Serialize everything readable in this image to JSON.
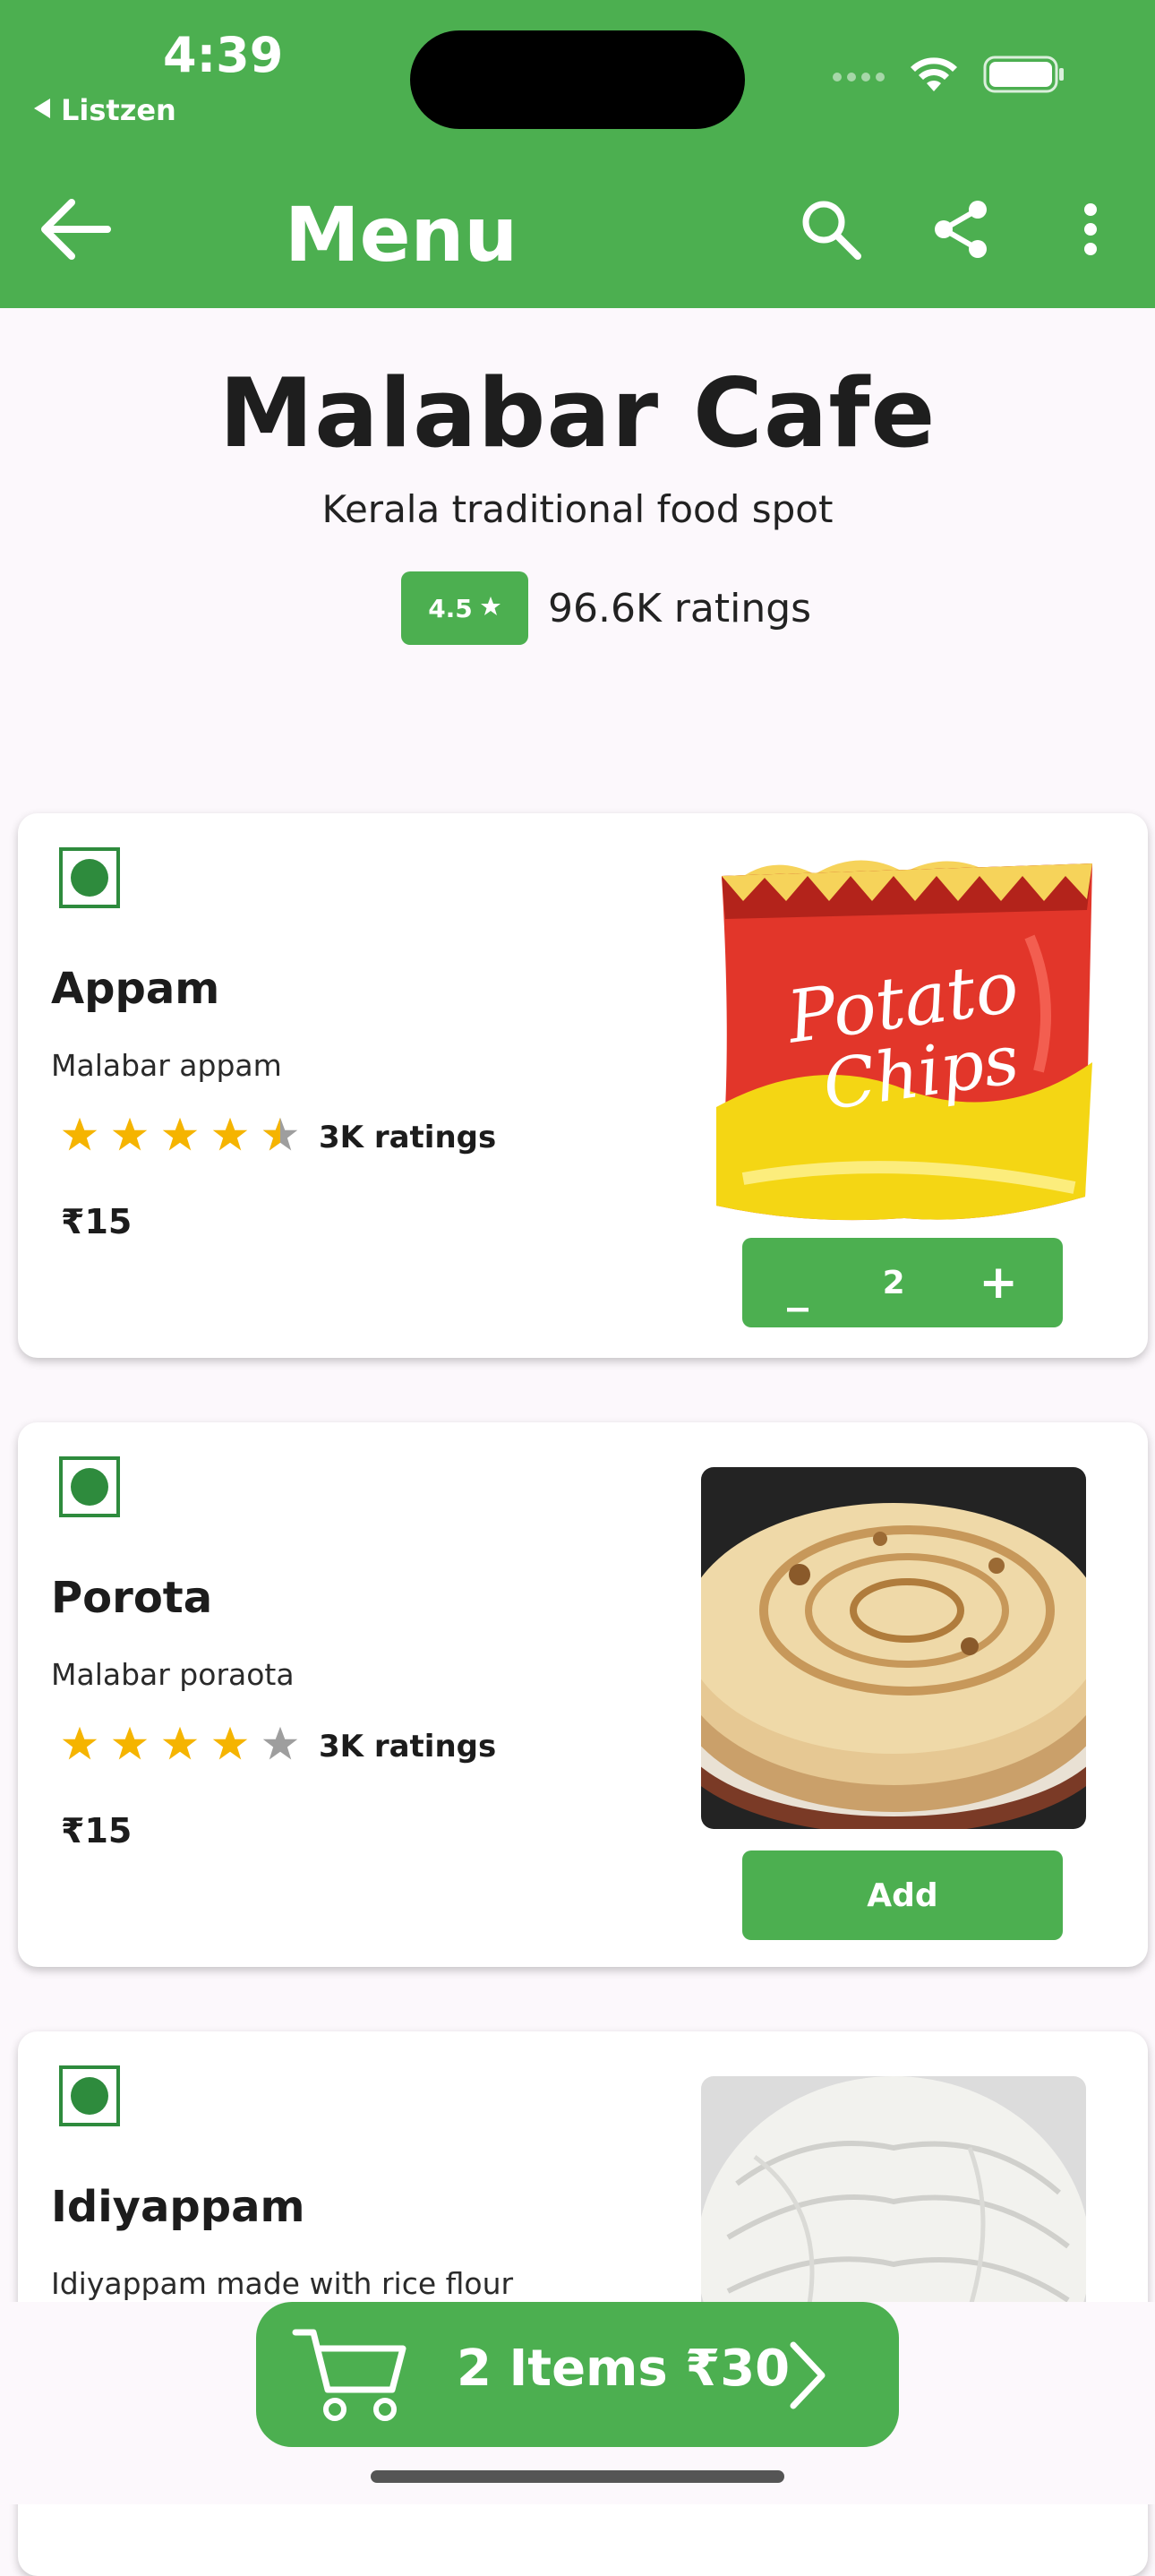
{
  "status_bar": {
    "time": "4:39",
    "back_app": "Listzen"
  },
  "app_bar": {
    "title": "Menu",
    "icons": [
      "back-arrow-icon",
      "search-icon",
      "share-icon",
      "more-vert-icon"
    ]
  },
  "restaurant": {
    "name": "Malabar Cafe",
    "subtitle": "Kerala traditional food spot",
    "rating": "4.5",
    "rating_count": "96.6K ratings"
  },
  "items": [
    {
      "name": "Appam",
      "description": "Malabar appam",
      "stars": 4.5,
      "ratings_label": "3K ratings",
      "price": "₹15",
      "image": "potato-chips-bag",
      "quantity": "2",
      "action": "stepper"
    },
    {
      "name": "Porota",
      "description": "Malabar poraota",
      "stars": 4,
      "ratings_label": "3K ratings",
      "price": "₹15",
      "image": "porota-flatbread",
      "action_label": "Add"
    },
    {
      "name": "Idiyappam",
      "description": "Idiyappam made with rice flour",
      "image": "idiyappam-noodles"
    }
  ],
  "cart": {
    "label": "2 Items ₹30"
  },
  "colors": {
    "primary": "#4caf50",
    "veg": "#2e8b3d",
    "star": "#f5b400",
    "star_empty": "#9e9e9e"
  }
}
